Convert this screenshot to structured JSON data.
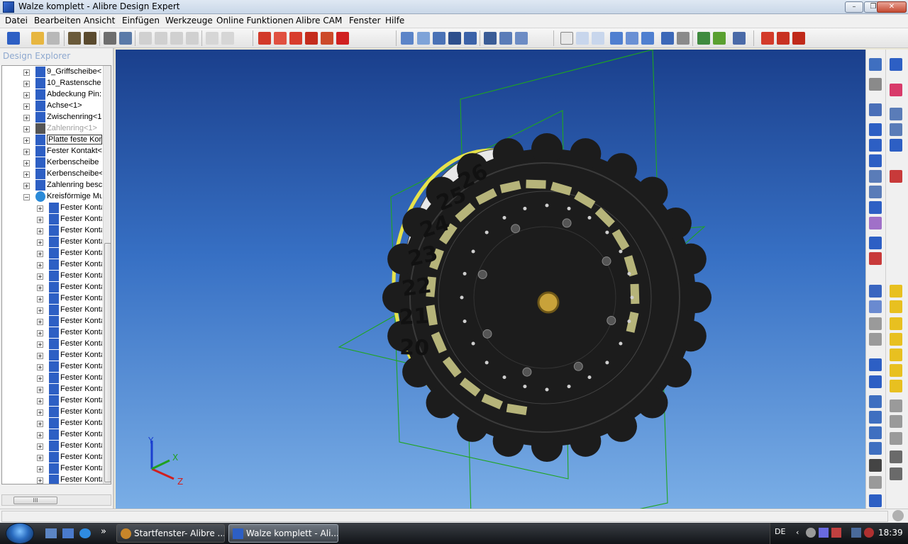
{
  "window": {
    "title": "Walze komplett - Alibre Design Expert",
    "minimize": "–",
    "maximize": "❐",
    "close": "✕"
  },
  "menu": [
    "Datei",
    "Bearbeiten",
    "Ansicht",
    "Einfügen",
    "Werkzeuge",
    "Online Funktionen",
    "Alibre CAM",
    "Fenster",
    "Hilfe"
  ],
  "explorer": {
    "title": "Design Explorer",
    "items": [
      {
        "label": "9_Griffscheibe<",
        "icon": "part-icon",
        "level": 0,
        "expand": "+"
      },
      {
        "label": "10_Rastensche",
        "icon": "part-icon",
        "level": 0,
        "expand": "+"
      },
      {
        "label": "Abdeckung Pin:",
        "icon": "part-icon",
        "level": 0,
        "expand": "+"
      },
      {
        "label": "Achse<1>",
        "icon": "part-icon",
        "level": 0,
        "expand": "+"
      },
      {
        "label": "Zwischenring<1",
        "icon": "part-icon",
        "level": 0,
        "expand": "+"
      },
      {
        "label": "Zahlenring<1>",
        "icon": "part-suppressed-icon",
        "level": 0,
        "expand": "+",
        "dim": true
      },
      {
        "label": "Platte feste Kon",
        "icon": "part-icon",
        "level": 0,
        "expand": "+",
        "boxed": true
      },
      {
        "label": "Fester Kontakt<",
        "icon": "part-icon",
        "level": 0,
        "expand": "+"
      },
      {
        "label": "Kerbenscheibe",
        "icon": "part-icon",
        "level": 0,
        "expand": "+"
      },
      {
        "label": "Kerbenscheibe<",
        "icon": "part-icon",
        "level": 0,
        "expand": "+"
      },
      {
        "label": "Zahlenring besc",
        "icon": "part-icon",
        "level": 0,
        "expand": "+"
      },
      {
        "label": "Kreisförmige Mu",
        "icon": "pattern-icon",
        "level": 0,
        "expand": "−"
      },
      {
        "label": "Fester Konta",
        "icon": "part-icon",
        "level": 1,
        "expand": "+"
      },
      {
        "label": "Fester Konta",
        "icon": "part-icon",
        "level": 1,
        "expand": "+"
      },
      {
        "label": "Fester Konta",
        "icon": "part-icon",
        "level": 1,
        "expand": "+"
      },
      {
        "label": "Fester Konta",
        "icon": "part-icon",
        "level": 1,
        "expand": "+"
      },
      {
        "label": "Fester Konta",
        "icon": "part-icon",
        "level": 1,
        "expand": "+"
      },
      {
        "label": "Fester Konta",
        "icon": "part-icon",
        "level": 1,
        "expand": "+"
      },
      {
        "label": "Fester Konta",
        "icon": "part-icon",
        "level": 1,
        "expand": "+"
      },
      {
        "label": "Fester Konta",
        "icon": "part-icon",
        "level": 1,
        "expand": "+"
      },
      {
        "label": "Fester Konta",
        "icon": "part-icon",
        "level": 1,
        "expand": "+"
      },
      {
        "label": "Fester Konta",
        "icon": "part-icon",
        "level": 1,
        "expand": "+"
      },
      {
        "label": "Fester Konta",
        "icon": "part-icon",
        "level": 1,
        "expand": "+"
      },
      {
        "label": "Fester Konta",
        "icon": "part-icon",
        "level": 1,
        "expand": "+"
      },
      {
        "label": "Fester Konta",
        "icon": "part-icon",
        "level": 1,
        "expand": "+"
      },
      {
        "label": "Fester Konta",
        "icon": "part-icon",
        "level": 1,
        "expand": "+"
      },
      {
        "label": "Fester Konta",
        "icon": "part-icon",
        "level": 1,
        "expand": "+"
      },
      {
        "label": "Fester Konta",
        "icon": "part-icon",
        "level": 1,
        "expand": "+"
      },
      {
        "label": "Fester Konta",
        "icon": "part-icon",
        "level": 1,
        "expand": "+"
      },
      {
        "label": "Fester Konta",
        "icon": "part-icon",
        "level": 1,
        "expand": "+"
      },
      {
        "label": "Fester Konta",
        "icon": "part-icon",
        "level": 1,
        "expand": "+"
      },
      {
        "label": "Fester Konta",
        "icon": "part-icon",
        "level": 1,
        "expand": "+"
      },
      {
        "label": "Fester Konta",
        "icon": "part-icon",
        "level": 1,
        "expand": "+"
      },
      {
        "label": "Fester Konta",
        "icon": "part-icon",
        "level": 1,
        "expand": "+"
      },
      {
        "label": "Fester Konta",
        "icon": "part-icon",
        "level": 1,
        "expand": "+"
      },
      {
        "label": "Fester Konta",
        "icon": "part-icon",
        "level": 1,
        "expand": "+"
      },
      {
        "label": "Fester Konta",
        "icon": "part-icon",
        "level": 1,
        "expand": "+"
      }
    ],
    "hscroll_label": "III"
  },
  "model": {
    "ring_numbers": [
      "26",
      "25",
      "24",
      "23",
      "22",
      "21",
      "20"
    ],
    "axes": {
      "x": "X",
      "y": "Y",
      "z": "Z"
    },
    "colors": {
      "body": "#1c1c1c",
      "ring": "#e8e8e8",
      "slots": "#b6b47a",
      "planes": "#1fa51f",
      "hub": "#c8a23a",
      "rim": "#e6e24a"
    }
  },
  "taskbar": {
    "items": [
      {
        "label": "Startfenster- Alibre ...",
        "active": false
      },
      {
        "label": "Walze komplett - Ali...",
        "active": true
      }
    ],
    "chevron": "»",
    "language": "DE",
    "clock": "18:39"
  }
}
